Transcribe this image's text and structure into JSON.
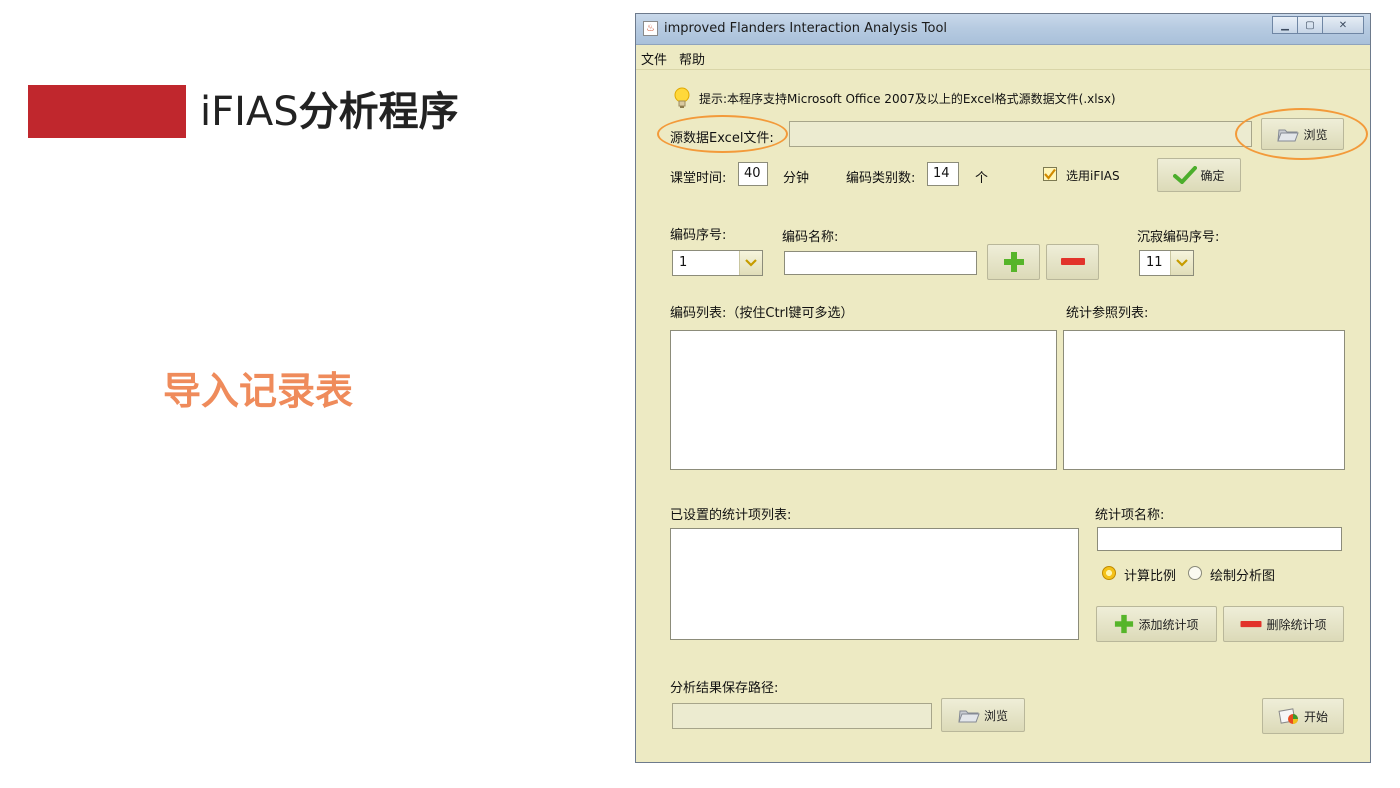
{
  "slide": {
    "title_latin": "iFIAS",
    "title_cjk": "分析程序",
    "subtitle": "导入记录表"
  },
  "window": {
    "title": "improved Flanders Interaction Analysis Tool",
    "menu": [
      "文件",
      "帮助"
    ]
  },
  "form": {
    "hint": "提示:本程序支持Microsoft Office 2007及以上的Excel格式源数据文件(.xlsx)",
    "source_label": "源数据Excel文件:",
    "source_value": "",
    "browse_label": "浏览",
    "class_time_label": "课堂时间:",
    "class_time_value": "40",
    "minute_label": "分钟",
    "code_count_label": "编码类别数:",
    "code_count_value": "14",
    "unit_label": "个",
    "use_ifias_label": "选用iFIAS",
    "use_ifias_checked": true,
    "confirm_label": "确定",
    "code_seq_label": "编码序号:",
    "code_seq_value": "1",
    "code_name_label": "编码名称:",
    "code_name_value": "",
    "silence_seq_label": "沉寂编码序号:",
    "silence_seq_value": "11",
    "code_list_label": "编码列表:（按住Ctrl键可多选）",
    "ref_list_label": "统计参照列表:",
    "stat_list_label": "已设置的统计项列表:",
    "stat_name_label": "统计项名称:",
    "stat_name_value": "",
    "radio_ratio": "计算比例",
    "radio_chart": "绘制分析图",
    "add_stat_label": "添加统计项",
    "del_stat_label": "删除统计项",
    "save_path_label": "分析结果保存路径:",
    "save_path_value": "",
    "save_browse_label": "浏览",
    "start_label": "开始"
  },
  "colors": {
    "accent_red": "#c0272d",
    "subtitle_orange": "#ef8b5b",
    "highlight_oval": "#f39a3a",
    "window_bg": "#edeac3"
  }
}
